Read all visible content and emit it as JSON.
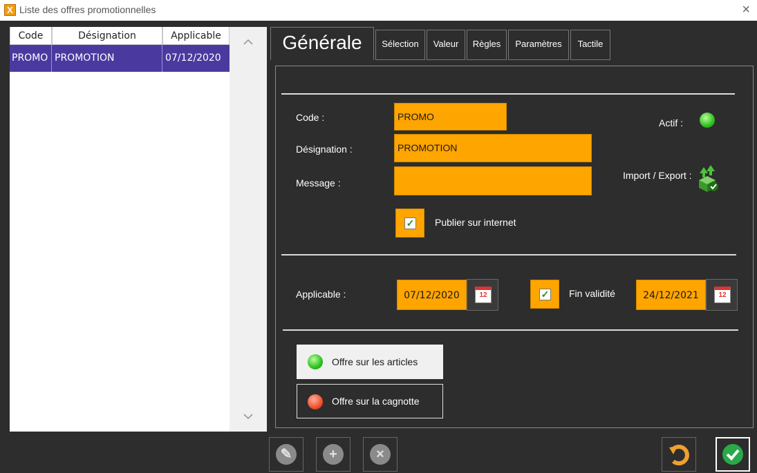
{
  "window": {
    "title": "Liste des offres promotionnelles",
    "close_glyph": "×"
  },
  "list": {
    "columns": [
      "Code",
      "Désignation",
      "Applicable"
    ],
    "rows": [
      {
        "code": "PROMO",
        "designation": "PROMOTION",
        "applicable": "07/12/2020"
      }
    ]
  },
  "tabs": [
    "Générale",
    "Sélection",
    "Valeur",
    "Règles",
    "Paramètres",
    "Tactile"
  ],
  "form": {
    "code_label": "Code :",
    "code_value": "PROMO",
    "designation_label": "Désignation :",
    "designation_value": "PROMOTION",
    "message_label": "Message :",
    "message_value": "",
    "actif_label": "Actif :",
    "import_export_label": "Import / Export :",
    "publier_label": "Publier sur internet",
    "publier_checked": true,
    "applicable_label": "Applicable :",
    "applicable_date": "07/12/2020",
    "fin_validite_label": "Fin validité",
    "fin_validite_checked": true,
    "fin_validite_date": "24/12/2021",
    "calendar_day": "12"
  },
  "offers": [
    {
      "label": "Offre sur les articles",
      "state": "selected",
      "led": "green"
    },
    {
      "label": "Offre sur la cagnotte",
      "state": "unselected",
      "led": "red"
    }
  ],
  "colors": {
    "field_orange": "#ffa500",
    "selected_row": "#4a3aa0",
    "background": "#2d2d2d"
  },
  "icons": [
    "app-logo-icon",
    "close-icon",
    "chevron-up-icon",
    "chevron-down-icon",
    "calendar-icon",
    "import-export-icon",
    "edit-icon",
    "add-icon",
    "delete-icon",
    "undo-icon",
    "validate-icon"
  ]
}
